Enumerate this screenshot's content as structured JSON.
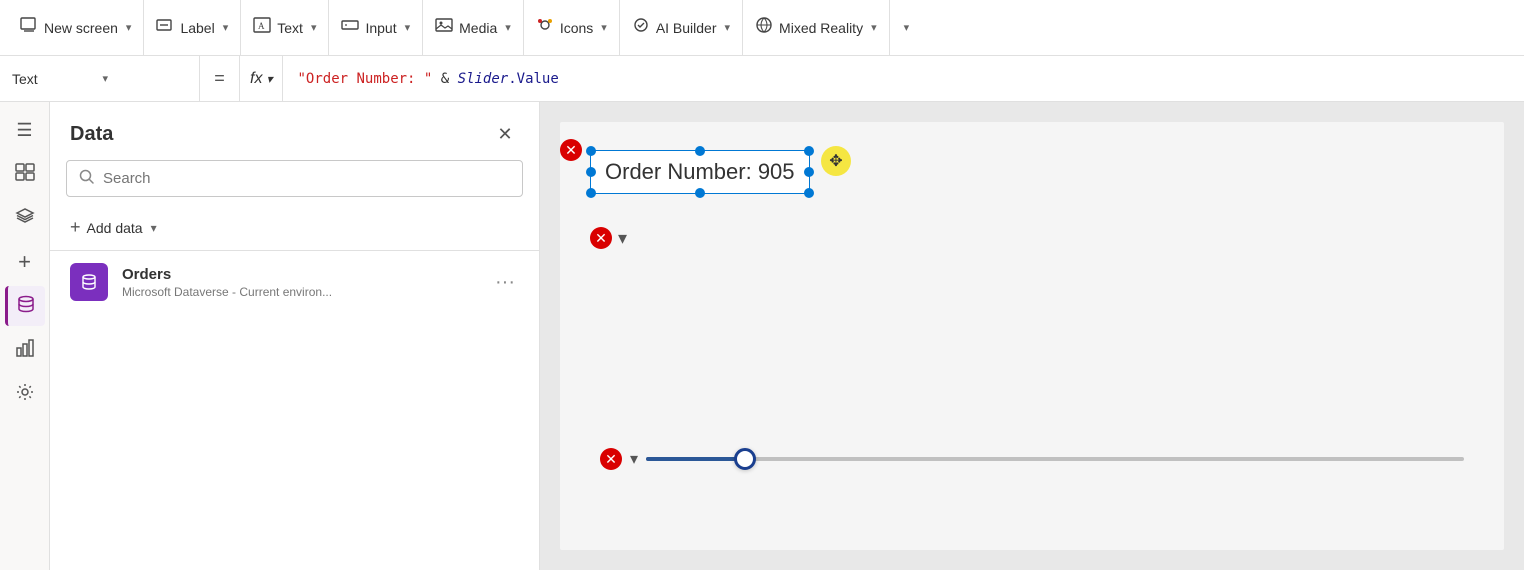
{
  "toolbar": {
    "new_screen_label": "New screen",
    "new_screen_chevron": "▾",
    "label_label": "Label",
    "label_chevron": "▾",
    "text_label": "Text",
    "text_chevron": "▾",
    "input_label": "Input",
    "input_chevron": "▾",
    "media_label": "Media",
    "media_chevron": "▾",
    "icons_label": "Icons",
    "icons_chevron": "▾",
    "ai_builder_label": "AI Builder",
    "ai_builder_chevron": "▾",
    "mixed_reality_label": "Mixed Reality",
    "mixed_reality_chevron": "▾",
    "overflow_chevron": "▾"
  },
  "formula_bar": {
    "property_label": "Text",
    "property_chevron": "▾",
    "equals": "=",
    "fx_label": "fx",
    "fx_chevron": "▾",
    "formula": "\"Order Number: \" & Slider.Value"
  },
  "data_panel": {
    "title": "Data",
    "close_icon": "✕",
    "search_placeholder": "Search",
    "add_data_label": "Add data",
    "add_data_chevron": "▾",
    "items": [
      {
        "name": "Orders",
        "description": "Microsoft Dataverse - Current environ...",
        "icon": "🗄"
      }
    ]
  },
  "canvas": {
    "text_element_content": "Order Number: 905",
    "slider_value": 905
  },
  "sidebar": {
    "icons": [
      {
        "name": "hamburger-menu-icon",
        "glyph": "☰",
        "active": false
      },
      {
        "name": "layers-icon",
        "glyph": "⊞",
        "active": false
      },
      {
        "name": "components-icon",
        "glyph": "⬡",
        "active": false
      },
      {
        "name": "add-icon",
        "glyph": "+",
        "active": false
      },
      {
        "name": "data-icon",
        "glyph": "🗄",
        "active": true
      },
      {
        "name": "analytics-icon",
        "glyph": "📊",
        "active": false
      },
      {
        "name": "settings-icon",
        "glyph": "⚙",
        "active": false
      }
    ]
  }
}
